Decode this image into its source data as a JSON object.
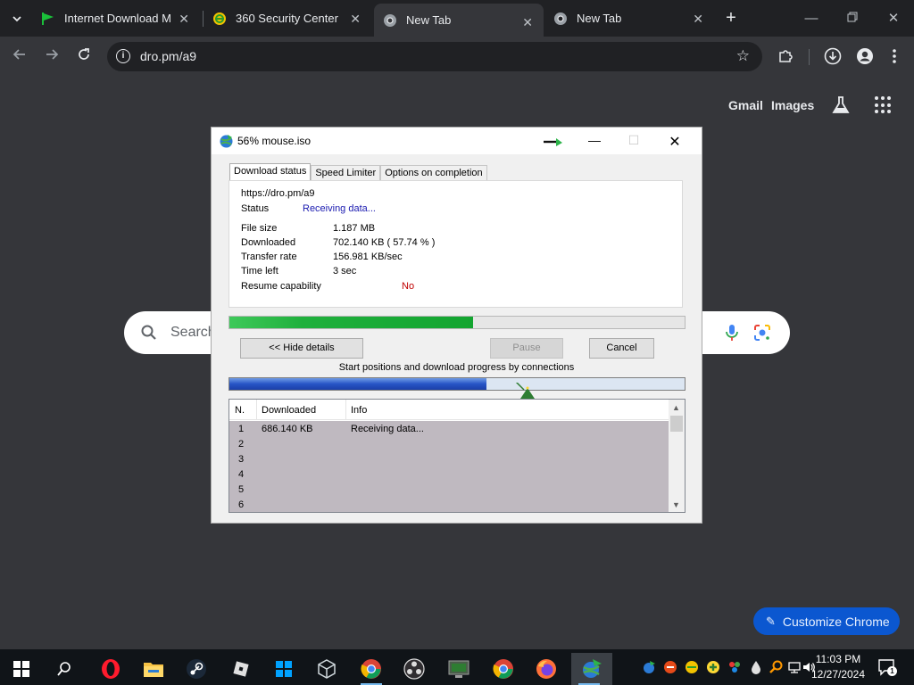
{
  "browser": {
    "tabs": [
      {
        "title": "Internet Download Ma",
        "icon": "idm-flag-icon"
      },
      {
        "title": "360 Security Center",
        "icon": "360-security-icon"
      },
      {
        "title": "New Tab",
        "icon": "chrome-icon",
        "active": true
      },
      {
        "title": "New Tab",
        "icon": "chrome-icon"
      }
    ],
    "address": "dro.pm/a9"
  },
  "newtab": {
    "gmail": "Gmail",
    "images": "Images",
    "search_placeholder": "Search",
    "customize": "Customize Chrome"
  },
  "idm": {
    "title": "56% mouse.iso",
    "tabs": [
      "Download status",
      "Speed Limiter",
      "Options on completion"
    ],
    "url": "https://dro.pm/a9",
    "status_label": "Status",
    "status_value": "Receiving data...",
    "file_size_label": "File size",
    "file_size_value": "1.187  MB",
    "downloaded_label": "Downloaded",
    "downloaded_value": "702.140  KB  ( 57.74 % )",
    "transfer_rate_label": "Transfer rate",
    "transfer_rate_value": "156.981  KB/sec",
    "time_left_label": "Time left",
    "time_left_value": "3 sec",
    "resume_label": "Resume capability",
    "resume_value": "No",
    "progress": 0.535,
    "connection_progress": 0.565,
    "hide_details": "<< Hide details",
    "pause": "Pause",
    "cancel": "Cancel",
    "connections_caption": "Start positions and download progress by connections",
    "table_headers": [
      "N.",
      "Downloaded",
      "Info"
    ],
    "rows": [
      {
        "n": "1",
        "downloaded": "686.140  KB",
        "info": "Receiving data..."
      },
      {
        "n": "2",
        "downloaded": "",
        "info": ""
      },
      {
        "n": "3",
        "downloaded": "",
        "info": ""
      },
      {
        "n": "4",
        "downloaded": "",
        "info": ""
      },
      {
        "n": "5",
        "downloaded": "",
        "info": ""
      },
      {
        "n": "6",
        "downloaded": "",
        "info": ""
      }
    ]
  },
  "taskbar": {
    "time": "11:03 PM",
    "date": "12/27/2024",
    "notification_count": "1"
  },
  "colors": {
    "chrome_dark": "#202124",
    "chrome_surface": "#35363a",
    "idm_green": "#13a530",
    "idm_blue": "#2754c6",
    "customize_blue": "#0b57d0"
  }
}
